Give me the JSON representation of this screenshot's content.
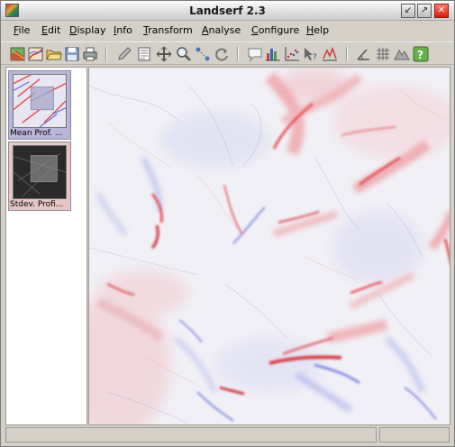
{
  "window": {
    "title": "Landserf 2.3",
    "buttons": {
      "minimize": "↙",
      "maximize": "↗",
      "close": "✕"
    }
  },
  "menubar": {
    "items": [
      {
        "first": "F",
        "rest": "ile"
      },
      {
        "first": "E",
        "rest": "dit"
      },
      {
        "first": "D",
        "rest": "isplay"
      },
      {
        "first": "I",
        "rest": "nfo"
      },
      {
        "first": "T",
        "rest": "ransform"
      },
      {
        "first": "A",
        "rest": "nalyse"
      },
      {
        "first": "C",
        "rest": "onfigure"
      },
      {
        "first": "H",
        "rest": "elp"
      }
    ]
  },
  "toolbar": {
    "icons": [
      "new-raster-icon",
      "new-vector-icon",
      "open-folder-icon",
      "save-icon",
      "print-icon",
      "edit-pencil-icon",
      "edit-text-icon",
      "pan-icon",
      "zoom-icon",
      "measure-icon",
      "refresh-icon",
      "comment-icon",
      "bar-chart-icon",
      "scatter-plot-icon",
      "query-icon",
      "profile-icon",
      "slope-icon",
      "grid-icon",
      "terrain-icon",
      "help-icon"
    ]
  },
  "thumbnails": [
    {
      "label": "Mean Prof. ...",
      "selected": true
    },
    {
      "label": "Stdev. Profi...",
      "selected": false
    }
  ],
  "status": {
    "left": "",
    "right": ""
  },
  "colors": {
    "positive": "#e05050",
    "negative": "#5a6ad8",
    "neutral": "#f2f1f6"
  }
}
